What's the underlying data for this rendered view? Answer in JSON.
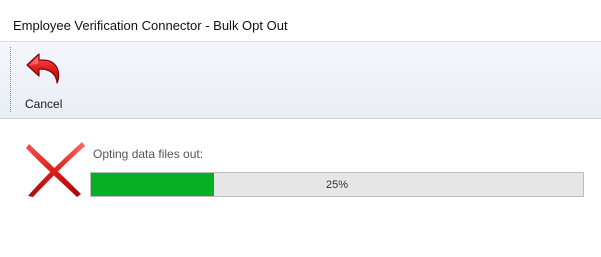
{
  "window": {
    "title": "Employee Verification Connector - Bulk Opt Out"
  },
  "toolbar": {
    "cancel_label": "Cancel",
    "cancel_icon": "undo-arrow-icon",
    "cancel_icon_color": "#d81e1e"
  },
  "status": {
    "icon": "red-x-icon",
    "icon_color": "#e21b1b",
    "label": "Opting data files out:"
  },
  "progress": {
    "value": 0.25,
    "text": "25%",
    "fill_color": "#06b025",
    "track_color": "#e6e6e6"
  }
}
